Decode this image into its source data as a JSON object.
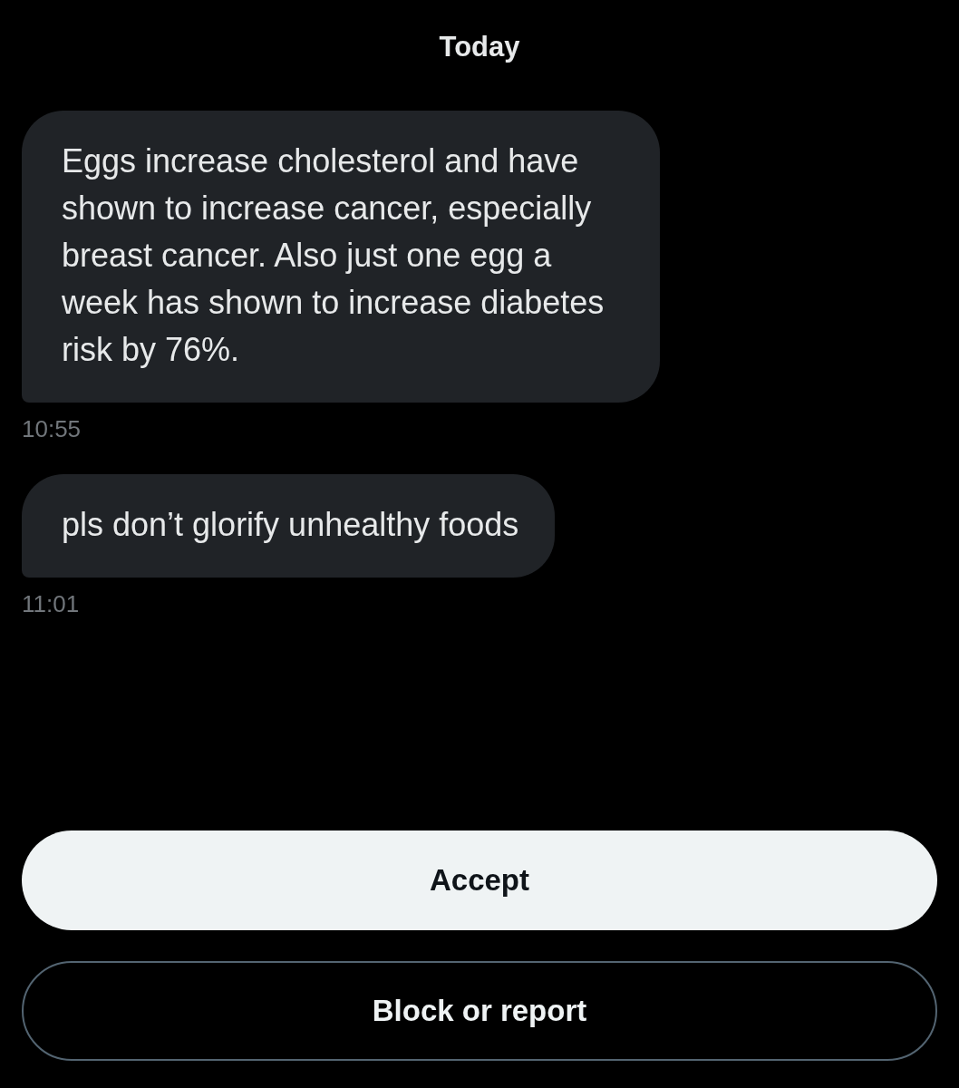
{
  "date_divider": "Today",
  "messages": [
    {
      "text": "Eggs increase cholesterol and have shown to increase cancer, especially breast cancer. Also just one egg a week has shown to increase diabetes risk by 76%.",
      "time": "10:55"
    },
    {
      "text": "pls don’t glorify unhealthy foods",
      "time": "11:01"
    }
  ],
  "buttons": [
    {
      "label": "Accept",
      "kind": "primary"
    },
    {
      "label": "Block or report",
      "kind": "outline"
    }
  ]
}
